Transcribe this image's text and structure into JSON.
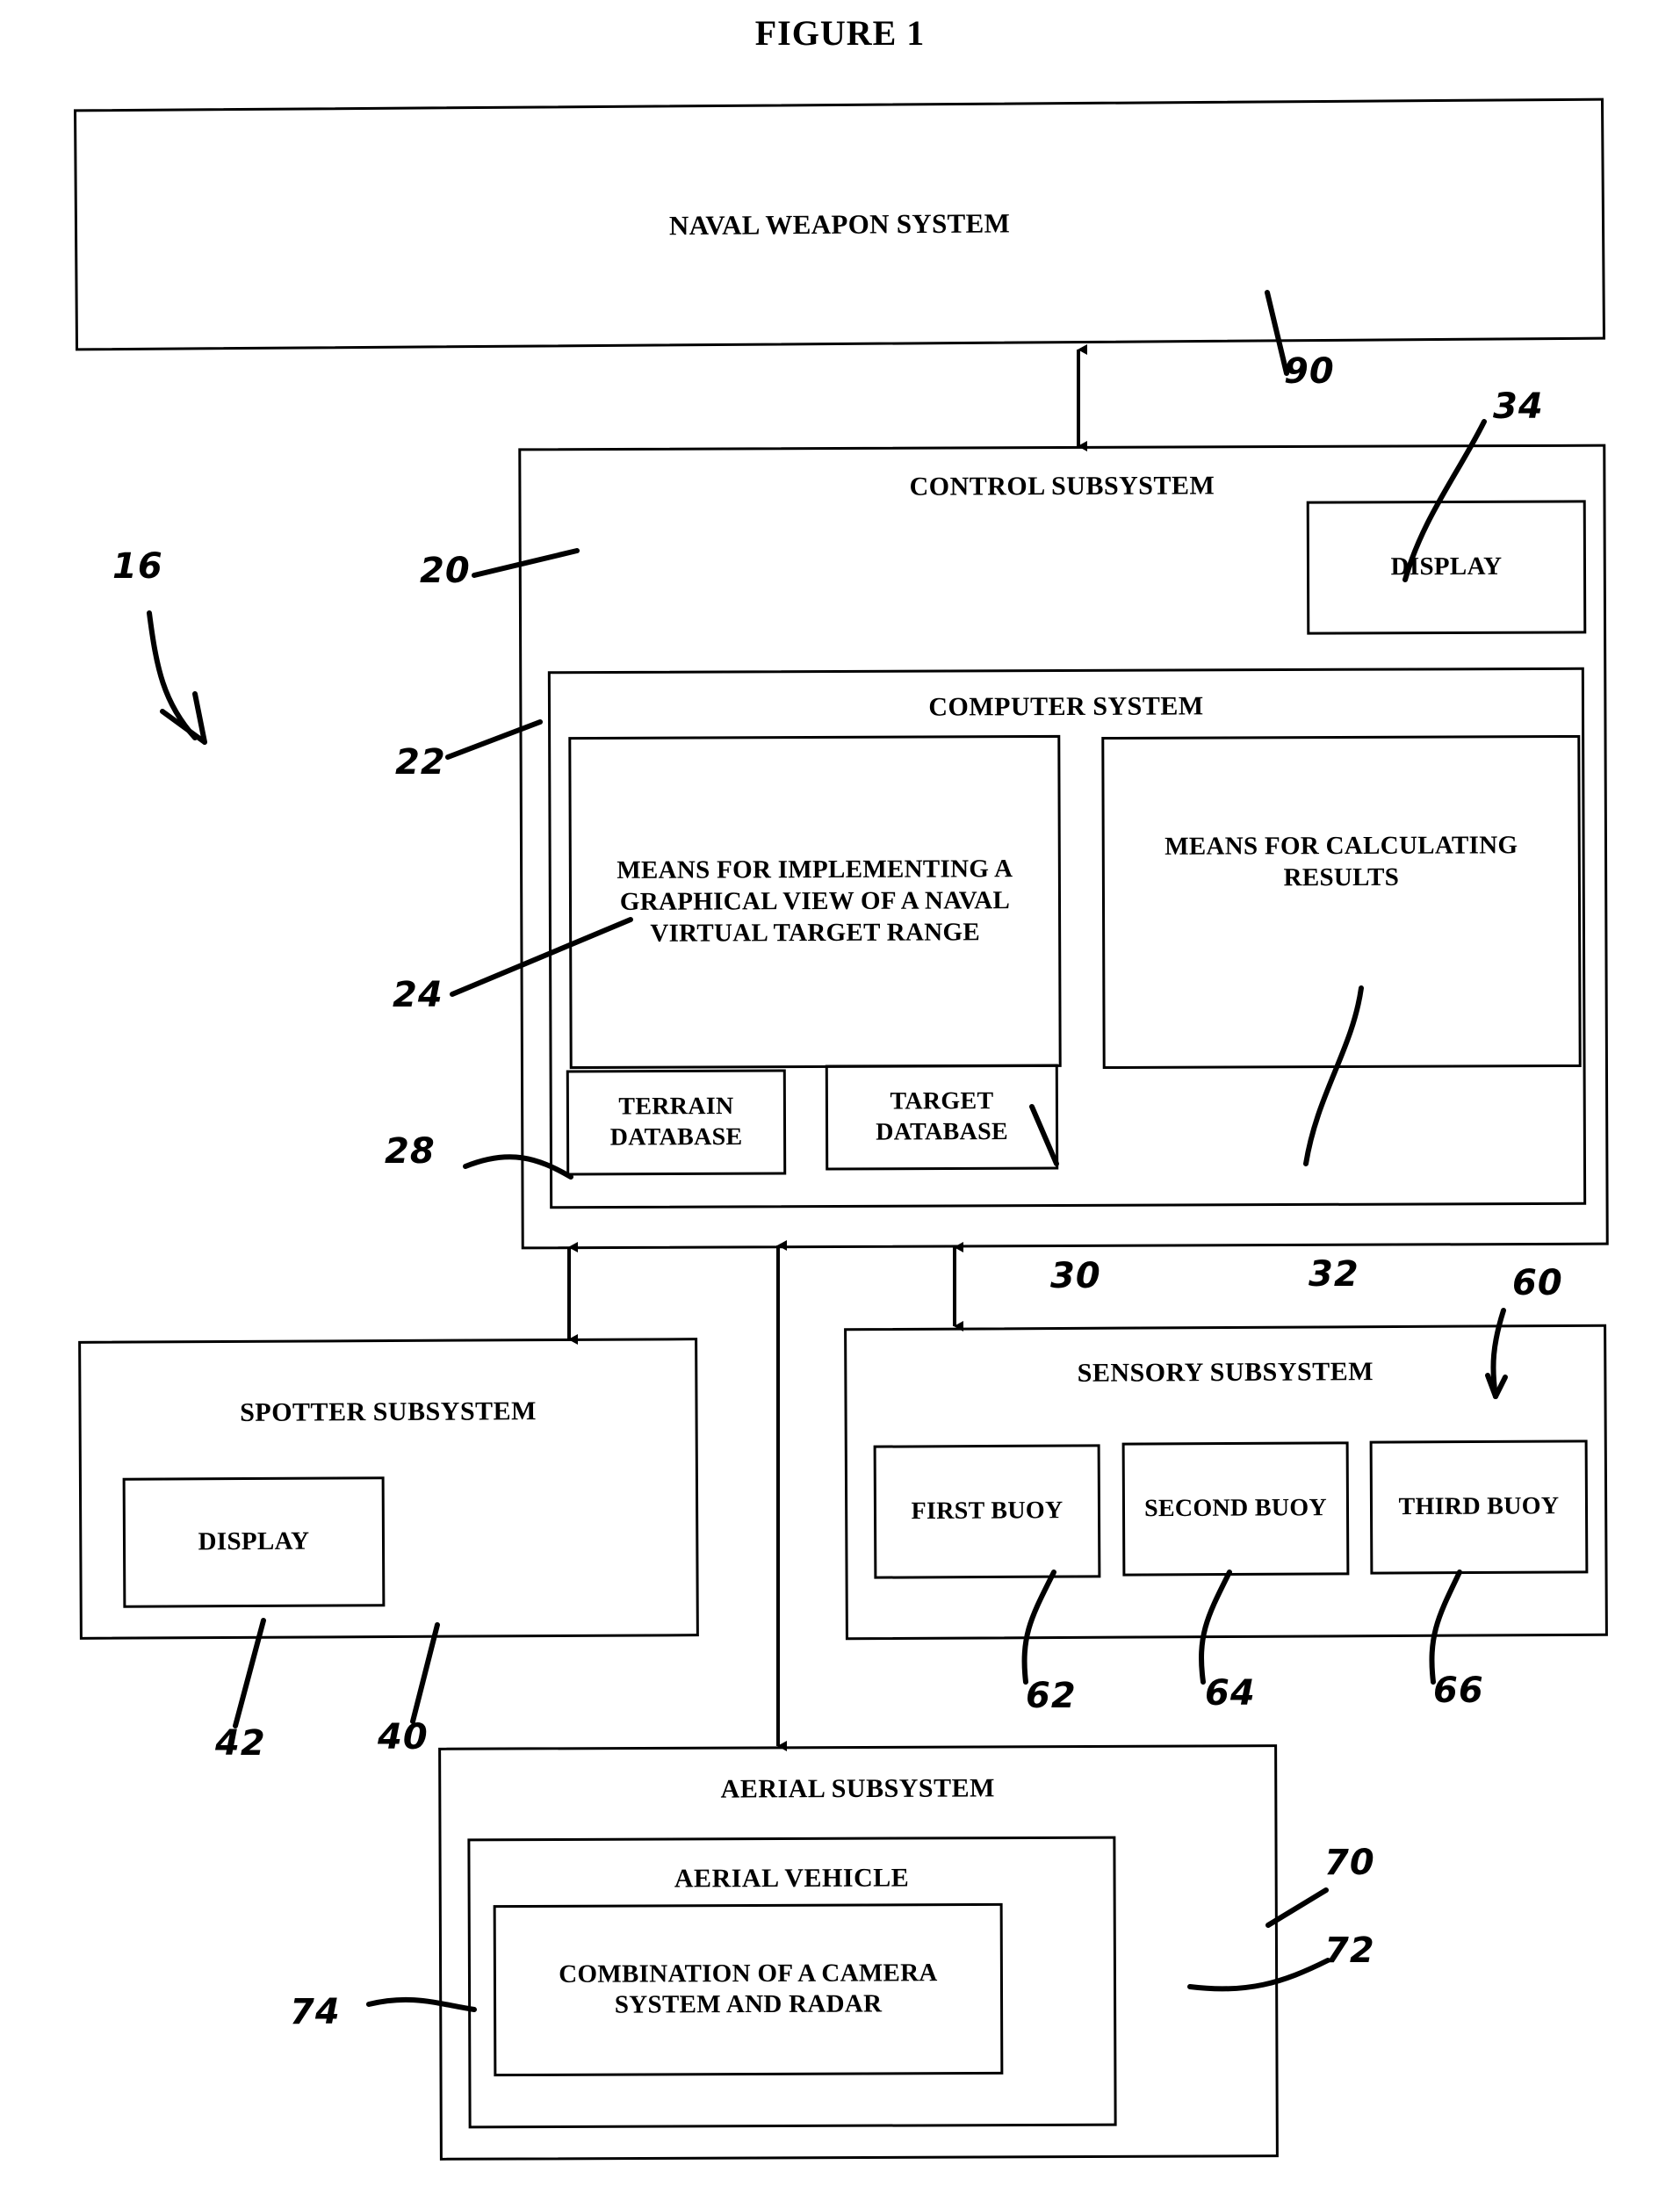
{
  "figure": {
    "title": "FIGURE 1"
  },
  "blocks": {
    "naval_weapon_system": "NAVAL WEAPON SYSTEM",
    "control_subsystem": "CONTROL SUBSYSTEM",
    "control_display": "DISPLAY",
    "computer_system": "COMPUTER SYSTEM",
    "means_graphical_view": "MEANS FOR IMPLEMENTING A GRAPHICAL VIEW OF A NAVAL VIRTUAL TARGET RANGE",
    "means_calculating_results": "MEANS FOR CALCULATING RESULTS",
    "terrain_database": "TERRAIN DATABASE",
    "target_database": "TARGET DATABASE",
    "spotter_subsystem": "SPOTTER SUBSYSTEM",
    "spotter_display": "DISPLAY",
    "sensory_subsystem": "SENSORY SUBSYSTEM",
    "first_buoy": "FIRST BUOY",
    "second_buoy": "SECOND BUOY",
    "third_buoy": "THIRD BUOY",
    "aerial_subsystem": "AERIAL SUBSYSTEM",
    "aerial_vehicle": "AERIAL VEHICLE",
    "camera_radar": "COMBINATION OF A CAMERA SYSTEM AND RADAR"
  },
  "reference_numerals": {
    "system": "16",
    "naval_weapon_system": "90",
    "control_subsystem": "20",
    "computer_system": "22",
    "means_graphical_view": "24",
    "terrain_database": "28",
    "target_database": "30",
    "means_calculating_results": "32",
    "control_display": "34",
    "spotter_subsystem": "40",
    "spotter_display": "42",
    "sensory_subsystem": "60",
    "first_buoy": "62",
    "second_buoy": "64",
    "third_buoy": "66",
    "aerial_subsystem": "70",
    "aerial_vehicle": "72",
    "camera_radar": "74"
  },
  "colors": {
    "ink": "#000000",
    "paper": "#ffffff"
  }
}
